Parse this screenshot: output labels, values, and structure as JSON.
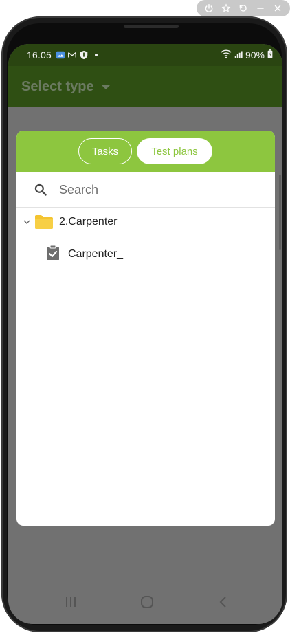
{
  "status_bar": {
    "time": "16.05",
    "battery": "90%",
    "icons": [
      "gallery-icon",
      "gmail-icon",
      "shield-icon",
      "dot",
      "wifi-icon",
      "signal-icon",
      "battery-icon"
    ]
  },
  "app_bar": {
    "title": "Select type",
    "caret_icon": "caret-down-icon"
  },
  "dialog": {
    "tabs": [
      {
        "label": "Tasks",
        "selected": false
      },
      {
        "label": "Test plans",
        "selected": true
      }
    ],
    "search": {
      "placeholder": "Search",
      "value": ""
    },
    "tree": {
      "folder": {
        "label": "2.Carpenter",
        "expanded": true,
        "icon": "folder-icon",
        "chevron_icon": "chevron-down-icon"
      },
      "items": [
        {
          "label": "Carpenter_",
          "icon": "task-checklist-icon"
        }
      ]
    }
  },
  "navigation": {
    "buttons": [
      "recents-icon",
      "home-icon",
      "back-icon"
    ]
  },
  "emulator_toolbar": {
    "buttons": [
      "power-icon",
      "star-icon",
      "rotate-icon",
      "minimize-icon",
      "close-icon"
    ]
  },
  "colors": {
    "status_bar": "#2a4511",
    "app_bar": "#2f4f13",
    "accent_green": "#8dc63f",
    "overlay": "#717171",
    "folder_yellow": "#f4c430",
    "task_icon_gray": "#6e6e6e"
  }
}
